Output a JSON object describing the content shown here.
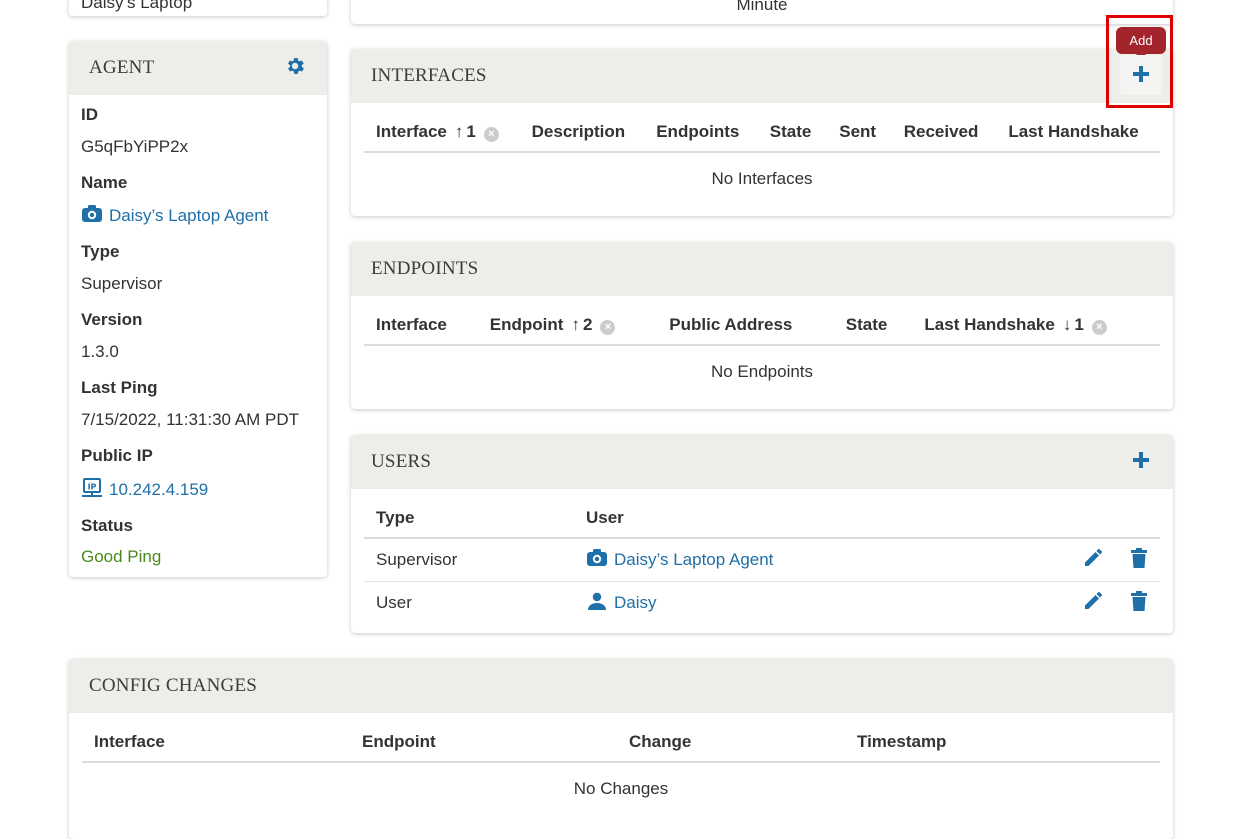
{
  "top_partial": {
    "left_text": "Daisy’s Laptop",
    "center_text": "Minute"
  },
  "agent_card": {
    "title": "AGENT",
    "settings_icon": "gear-icon",
    "fields": {
      "id_label": "ID",
      "id_value": "G5qFbYiPP2x",
      "name_label": "Name",
      "name_value": "Daisy’s Laptop Agent",
      "name_icon": "agent-icon",
      "type_label": "Type",
      "type_value": "Supervisor",
      "version_label": "Version",
      "version_value": "1.3.0",
      "last_ping_label": "Last Ping",
      "last_ping_value": "7/15/2022, 11:31:30 AM PDT",
      "public_ip_label": "Public IP",
      "public_ip_value": "10.242.4.159",
      "public_ip_icon": "ip-icon",
      "status_label": "Status",
      "status_value": "Good Ping",
      "status_color": "#4a8a1c"
    }
  },
  "interfaces_card": {
    "title": "INTERFACES",
    "add_tooltip": "Add",
    "add_icon": "plus-icon",
    "columns": [
      "Interface",
      "Description",
      "Endpoints",
      "State",
      "Sent",
      "Received",
      "Last Handshake"
    ],
    "sort_indicator": "1",
    "empty_text": "No Interfaces"
  },
  "endpoints_card": {
    "title": "ENDPOINTS",
    "columns": [
      "Interface",
      "Endpoint",
      "Public Address",
      "State",
      "Last Handshake"
    ],
    "endpoint_sort": "2",
    "handshake_sort": "1",
    "empty_text": "No Endpoints"
  },
  "users_card": {
    "title": "USERS",
    "add_icon": "plus-icon",
    "columns": [
      "Type",
      "User"
    ],
    "rows": [
      {
        "type": "Supervisor",
        "user": "Daisy’s Laptop Agent",
        "icon": "agent-icon"
      },
      {
        "type": "User",
        "user": "Daisy",
        "icon": "person-icon"
      }
    ]
  },
  "config_card": {
    "title": "CONFIG CHANGES",
    "columns": [
      "Interface",
      "Endpoint",
      "Change",
      "Timestamp"
    ],
    "empty_text": "No Changes"
  },
  "colors": {
    "accent": "#1f6fa8",
    "header_bg": "#ededea",
    "tooltip_bg": "#a3242a",
    "highlight": "#e00000"
  }
}
